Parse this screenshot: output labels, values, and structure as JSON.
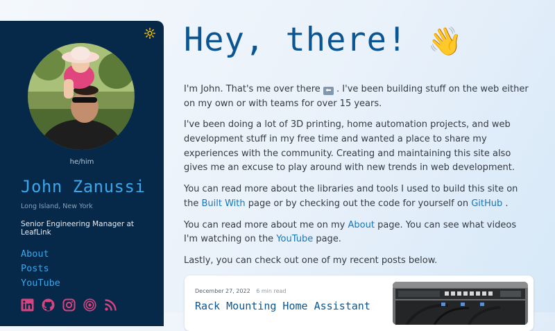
{
  "sidebar": {
    "pronouns": "he/him",
    "name": "John Zanussi",
    "location": "Long Island, New York",
    "job_title": "Senior Engineering Manager at LeafLink",
    "nav": [
      {
        "label": "About"
      },
      {
        "label": "Posts"
      },
      {
        "label": "YouTube"
      }
    ],
    "socials": [
      "linkedin-icon",
      "github-icon",
      "instagram-icon",
      "podcast-icon",
      "rss-icon"
    ],
    "theme_toggle_icon": "sun-icon"
  },
  "main": {
    "heading": "Hey, there!",
    "wave_emoji": "👋",
    "p1": {
      "before": "I'm John. That's me over there",
      "arrow": "⬅",
      "after": ". I've been building stuff on the web either on my own or with teams for over 15 years."
    },
    "p2": "I've been doing a lot of 3D printing, home automation projects, and web development stuff in my free time and wanted a place to share my experiences with the community. Creating and maintaining this site also gives me an excuse to play around with new trends in web development.",
    "p3": {
      "before": "You can read more about the libraries and tools I used to build this site on the",
      "link1": "Built With",
      "middle": "page or by checking out the code for yourself on",
      "link2": "GitHub",
      "after": "."
    },
    "p4": {
      "before": "You can read more about me on my",
      "link1": "About",
      "middle": "page. You can see what videos I'm watching on the",
      "link2": "YouTube",
      "after": "page."
    },
    "p5": "Lastly, you can check out one of my recent posts below."
  },
  "post": {
    "date": "December 27, 2022",
    "read_time": "6 min read",
    "title": "Rack Mounting Home Assistant"
  },
  "colors": {
    "sidebar_bg": "#06294a",
    "accent": "#3ba6ea",
    "heading": "#0a5592",
    "link": "#1576b8",
    "social_icons": "#d5457f"
  }
}
